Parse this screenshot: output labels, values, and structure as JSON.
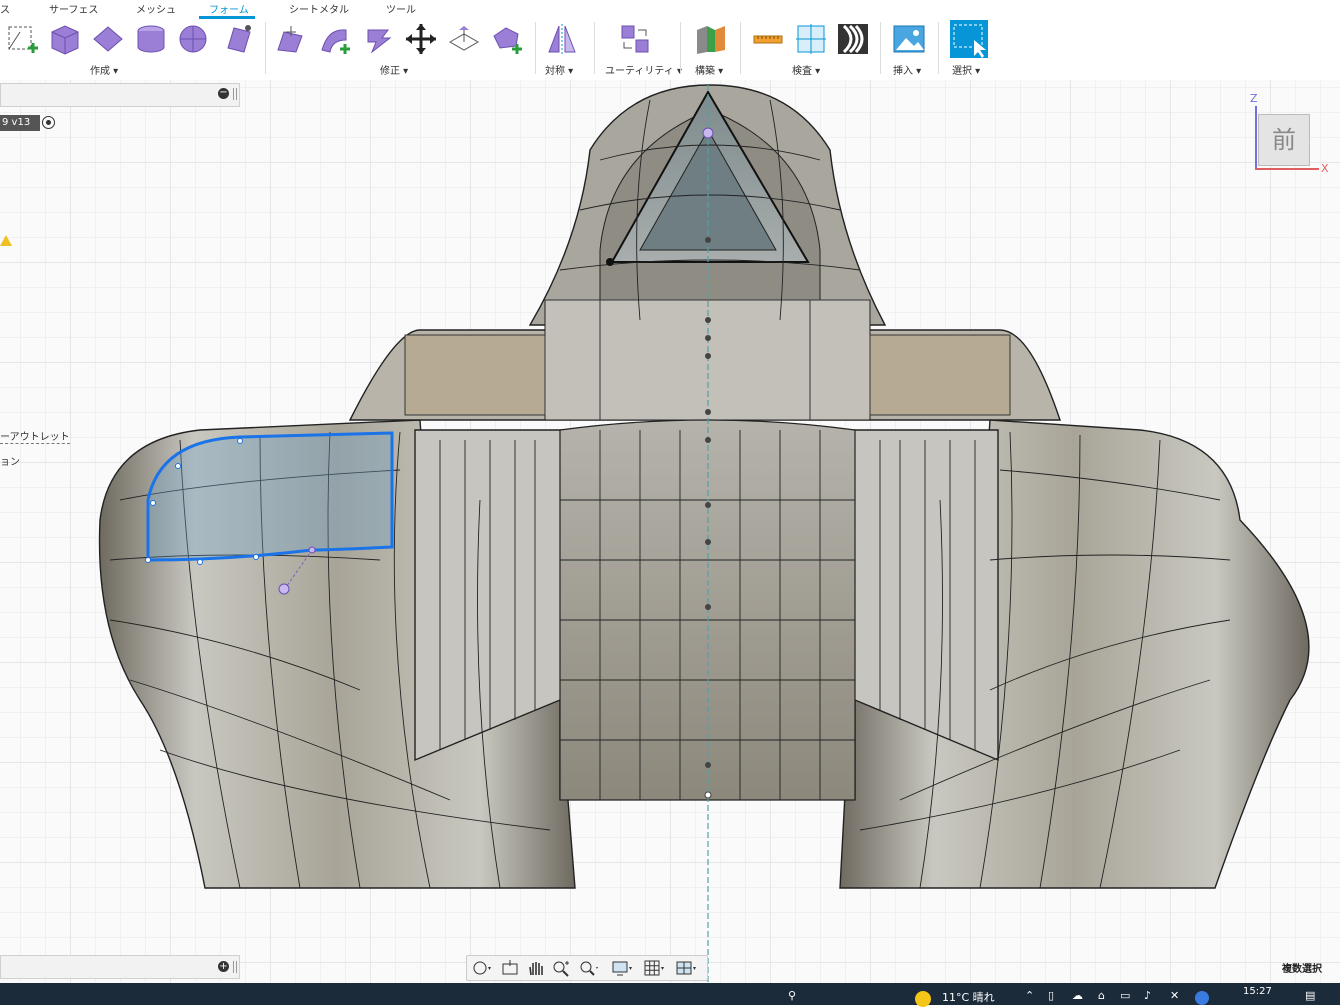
{
  "ribbon": {
    "tabs": [
      {
        "label": "ス"
      },
      {
        "label": "サーフェス"
      },
      {
        "label": "メッシュ"
      },
      {
        "label": "フォーム"
      },
      {
        "label": "シートメタル"
      },
      {
        "label": "ツール"
      }
    ],
    "active_tab": "フォーム",
    "groups": {
      "create": "作成 ▾",
      "modify": "修正 ▾",
      "symmetry": "対称 ▾",
      "utility": "ユーティリティ ▾",
      "construct": "構築 ▾",
      "inspect": "検査 ▾",
      "insert": "挿入 ▾",
      "select": "選択 ▾"
    },
    "accent_color": "#0696d7",
    "tool_color": "#9b7fd6"
  },
  "browser": {
    "document_version": "9 v13",
    "row_outlet": "ーアウトレット",
    "row_tion": "ョン"
  },
  "viewcube": {
    "face_label": "前",
    "axis_z": "Z",
    "axis_x": "X"
  },
  "status": {
    "selection_mode": "複数選択"
  },
  "taskbar": {
    "weather": "11°C 晴れ",
    "time": "15:27"
  }
}
